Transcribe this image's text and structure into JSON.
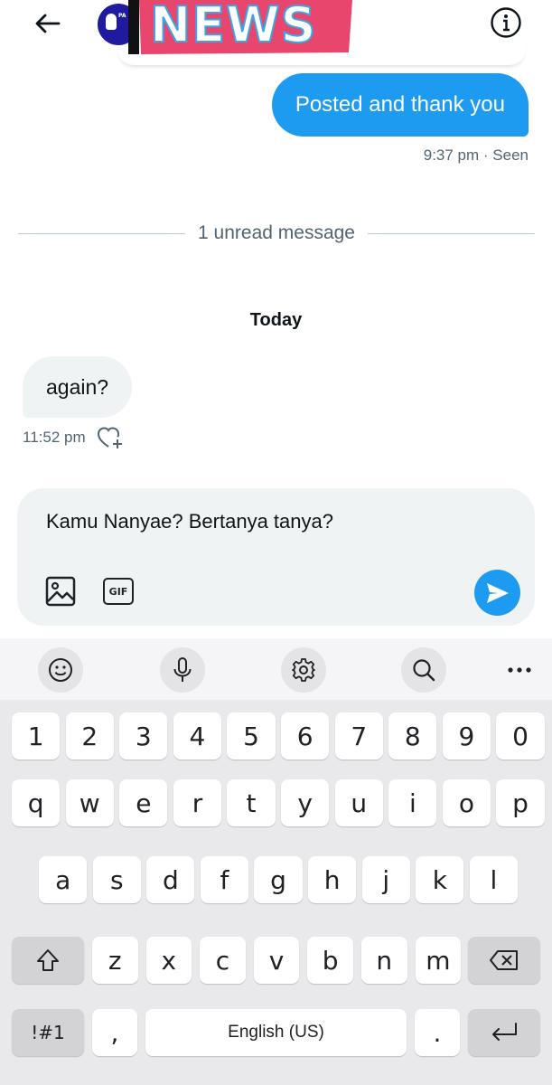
{
  "header": {
    "back_icon": "arrow-left-icon",
    "info_icon": "info-circle-icon",
    "avatar_text": "PA",
    "sticker_text": "NEWS"
  },
  "chat": {
    "sent_message": "Posted and thank you",
    "sent_meta": "9:37 pm · Seen",
    "unread_divider": "1 unread message",
    "date_label": "Today",
    "received_message": "again?",
    "received_time": "11:52 pm"
  },
  "composer": {
    "input_value": "Kamu Nanyae? Bertanya tanya?",
    "gif_label": "GIF"
  },
  "keyboard": {
    "number_row": [
      "1",
      "2",
      "3",
      "4",
      "5",
      "6",
      "7",
      "8",
      "9",
      "0"
    ],
    "row1": [
      "q",
      "w",
      "e",
      "r",
      "t",
      "y",
      "u",
      "i",
      "o",
      "p"
    ],
    "row2": [
      "a",
      "s",
      "d",
      "f",
      "g",
      "h",
      "j",
      "k",
      "l"
    ],
    "row3": [
      "z",
      "x",
      "c",
      "v",
      "b",
      "n",
      "m"
    ],
    "symbols_label": "!#1",
    "comma_label": ",",
    "space_label": "English (US)",
    "period_label": "."
  },
  "colors": {
    "accent": "#1d9bf0",
    "bubble_received": "#eff3f4",
    "meta_text": "#536471",
    "keyboard_bg": "#e9e9eb"
  }
}
